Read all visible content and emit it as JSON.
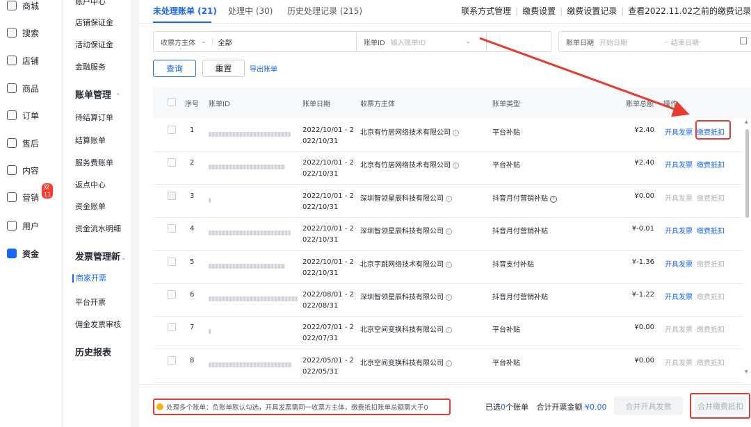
{
  "nav": {
    "items": [
      {
        "label": "商城",
        "icon": "mall-icon"
      },
      {
        "label": "搜索",
        "icon": "search-icon"
      },
      {
        "label": "店铺",
        "icon": "store-icon"
      },
      {
        "label": "商品",
        "icon": "goods-icon"
      },
      {
        "label": "订单",
        "icon": "order-icon"
      },
      {
        "label": "售后",
        "icon": "aftersale-icon"
      },
      {
        "label": "内容",
        "icon": "content-icon"
      },
      {
        "label": "营销",
        "icon": "marketing-icon",
        "badge": "双11"
      },
      {
        "label": "用户",
        "icon": "user-icon"
      },
      {
        "label": "资金",
        "icon": "funds-icon",
        "active": true
      }
    ]
  },
  "submenu": {
    "top_cut": "账户中心",
    "finance_items": [
      "店铺保证金",
      "活动保证金",
      "金融服务"
    ],
    "bill_head": "账单管理",
    "bill_items": [
      "待结算订单",
      "结算账单",
      "服务费账单",
      "返点中心",
      "资金账单",
      "资金流水明细"
    ],
    "invoice_head": "发票管理新",
    "invoice_items": [
      "商家开票",
      "平台开票",
      "佣金发票审核"
    ],
    "history_head": "历史报表"
  },
  "tabs": [
    {
      "label": "未处理账单 (21)",
      "active": true
    },
    {
      "label": "处理中 (30)"
    },
    {
      "label": "历史处理记录 (215)"
    }
  ],
  "top_links": [
    "联系方式管理",
    "缴费设置",
    "缴费设置记录",
    "查看2022.11.02之前的缴费记录"
  ],
  "filters": {
    "payee_label": "收票方主体",
    "payee_value": "全部",
    "bill_id_label": "账单ID",
    "bill_id_placeholder": "输入账单ID",
    "date_label": "账单日期",
    "start_placeholder": "开始日期",
    "end_placeholder": "结束日期"
  },
  "actions": {
    "query": "查询",
    "reset": "重置",
    "export": "导出账单"
  },
  "table": {
    "headers": {
      "index": "序号",
      "bill_id": "账单ID",
      "date": "账单日期",
      "payee": "收票方主体",
      "type": "账单类型",
      "total": "账单总额",
      "op": "操作"
    },
    "rows": [
      {
        "index": "1",
        "date1": "2022/10/01 - 2",
        "date2": "022/10/31",
        "payee": "北京有竹居网络技术有限公司",
        "type": "平台补贴",
        "amount": "¥2.40",
        "invoice": "开具发票",
        "deduct": "缴费抵扣",
        "invoice_enabled": true,
        "deduct_enabled": true,
        "disabled_cb": false
      },
      {
        "index": "2",
        "date1": "2022/10/01 - 2",
        "date2": "022/10/31",
        "payee": "北京有竹居网络技术有限公司",
        "type": "平台补贴",
        "amount": "¥2.40",
        "invoice": "开具发票",
        "deduct": "缴费抵扣",
        "invoice_enabled": true,
        "deduct_enabled": true,
        "disabled_cb": false
      },
      {
        "index": "3",
        "date1": "2022/10/01 - 2",
        "date2": "022/10/31",
        "payee": "深圳智领星辰科技有限公司",
        "type": "抖音月付营销补贴",
        "amount": "¥0.00",
        "invoice": "开具发票",
        "deduct": "缴费抵扣",
        "invoice_enabled": false,
        "deduct_enabled": false,
        "disabled_cb": true
      },
      {
        "index": "4",
        "date1": "2022/10/01 - 2",
        "date2": "022/10/31",
        "payee": "深圳智领星辰科技有限公司",
        "type": "抖音月付营销补贴",
        "amount": "¥-0.01",
        "invoice": "开具发票",
        "deduct": "缴费抵扣",
        "invoice_enabled": true,
        "deduct_enabled": true,
        "disabled_cb": false
      },
      {
        "index": "5",
        "date1": "2022/10/01 - 2",
        "date2": "022/10/31",
        "payee": "北京字跳网络技术有限公司",
        "type": "抖音支付补贴",
        "amount": "¥-1.36",
        "invoice": "开具发票",
        "deduct": "缴费抵扣",
        "invoice_enabled": true,
        "deduct_enabled": false,
        "disabled_cb": false
      },
      {
        "index": "6",
        "date1": "2022/08/01 - 2",
        "date2": "022/08/31",
        "payee": "深圳智领星辰科技有限公司",
        "type": "抖音月付营销补贴",
        "amount": "¥-1.22",
        "invoice": "开具发票",
        "deduct": "缴费抵扣",
        "invoice_enabled": true,
        "deduct_enabled": false,
        "disabled_cb": false
      },
      {
        "index": "7",
        "date1": "2022/07/01 - 2",
        "date2": "022/07/31",
        "payee": "北京空间变换科技有限公司",
        "type": "平台补贴",
        "amount": "¥0.00",
        "invoice": "开具发票",
        "deduct": "缴费抵扣",
        "invoice_enabled": false,
        "deduct_enabled": false,
        "disabled_cb": false
      },
      {
        "index": "8",
        "date1": "2022/05/01 - 2",
        "date2": "022/05/31",
        "payee": "北京空间变换科技有限公司",
        "type": "平台补贴",
        "amount": "¥0.00",
        "invoice": "开具发票",
        "deduct": "缴费抵扣",
        "invoice_enabled": false,
        "deduct_enabled": false,
        "disabled_cb": false
      }
    ]
  },
  "footer": {
    "tip": "处理多个账单：负账单默认勾选，开具发票需同一收票方主体，缴费抵扣账单总额需大于0",
    "selected_prefix": "已选",
    "selected_count": "0",
    "selected_suffix": "个账单",
    "total_label": "合计开票金额",
    "total_value": "¥0.00",
    "merge_invoice": "合并开具发票",
    "merge_deduct": "合并缴费抵扣"
  },
  "colors": {
    "accent": "#1966ff",
    "annotation_red": "#e83a30"
  }
}
